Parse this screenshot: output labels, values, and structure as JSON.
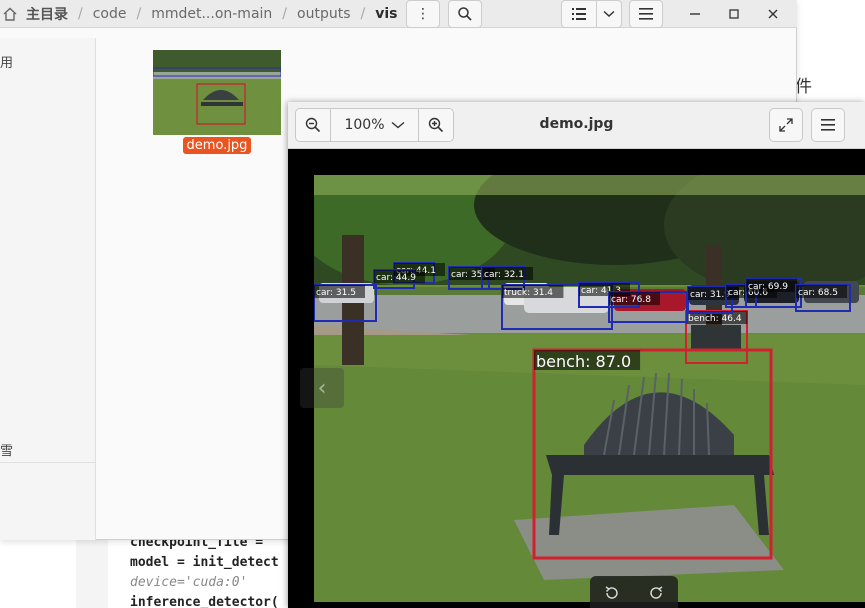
{
  "breadcrumb": {
    "items": [
      "主目录",
      "code",
      "mmdet...on-main",
      "outputs",
      "vis"
    ]
  },
  "sidebar": {
    "partial_top": "用",
    "partial_bottom": "雪"
  },
  "files": [
    {
      "name": "demo.jpg"
    }
  ],
  "background_editor": {
    "right_partial_text": "件",
    "code_lines": [
      {
        "text": "checkpoint_file =",
        "style": "code"
      },
      {
        "text": "model = init_detect",
        "style": "code"
      },
      {
        "text": "device='cuda:0'",
        "style": "comment"
      },
      {
        "text": "inference_detector(",
        "style": "code"
      }
    ]
  },
  "viewer": {
    "title": "demo.jpg",
    "zoom_label": "100%",
    "detections": [
      {
        "label": "bench: 87.0",
        "color": "#d2202f"
      },
      {
        "label": "bench: 46.4",
        "color": "#d2202f"
      },
      {
        "label": "car: 31.5",
        "color": "#1f2bb0"
      },
      {
        "label": "car: 44.1",
        "color": "#1f2bb0"
      },
      {
        "label": "car: 44.9",
        "color": "#1f2bb0"
      },
      {
        "label": "car: 35.",
        "color": "#1f2bb0"
      },
      {
        "label": "car: 32.1",
        "color": "#1f2bb0"
      },
      {
        "label": "truck: 31.4",
        "color": "#1f2bb0"
      },
      {
        "label": "car: 41.3",
        "color": "#1f2bb0"
      },
      {
        "label": "car: 76.8",
        "color": "#1f2bb0"
      },
      {
        "label": "car: 31.9",
        "color": "#1f2bb0"
      },
      {
        "label": "car: 60.6",
        "color": "#1f2bb0"
      },
      {
        "label": "car: 69.9",
        "color": "#1f2bb0"
      },
      {
        "label": "car: 68.5",
        "color": "#1f2bb0"
      }
    ]
  },
  "colors": {
    "accent": "#e95420",
    "header_bg": "#ebebeb",
    "viewer_bg": "#000000"
  }
}
